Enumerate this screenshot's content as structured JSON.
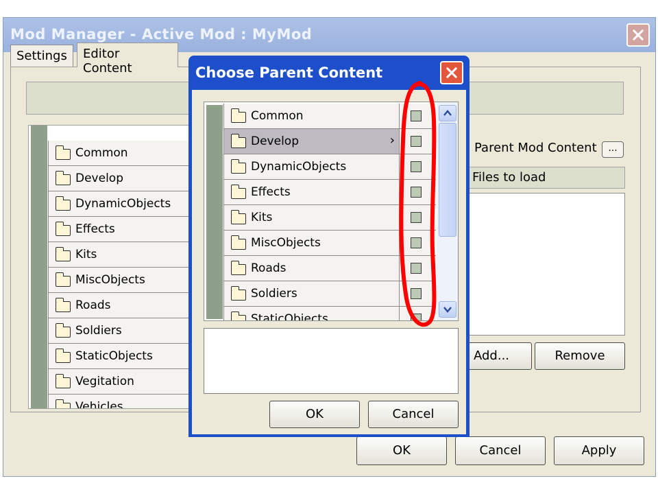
{
  "main_window": {
    "title": "Mod Manager - Active Mod : MyMod",
    "tabs": [
      {
        "label": "Settings"
      },
      {
        "label": "Editor Content"
      }
    ],
    "folders": [
      "Common",
      "Develop",
      "DynamicObjects",
      "Effects",
      "Kits",
      "MiscObjects",
      "Roads",
      "Soldiers",
      "StaticObjects",
      "Vegitation",
      "Vehicles"
    ],
    "parent_mod_label": "Parent Mod Content",
    "browse_label": "...",
    "files_header": "Files to load",
    "add_label": "Add...",
    "remove_label": "Remove",
    "ok_label": "OK",
    "cancel_label": "Cancel",
    "apply_label": "Apply"
  },
  "dialog": {
    "title": "Choose Parent Content",
    "folders": [
      "Common",
      "Develop",
      "DynamicObjects",
      "Effects",
      "Kits",
      "MiscObjects",
      "Roads",
      "Soldiers",
      "StaticObjects"
    ],
    "selected_index": 1,
    "ok_label": "OK",
    "cancel_label": "Cancel"
  },
  "colors": {
    "dialog_frame": "#1c4fc9",
    "annotation": "#ff0000",
    "gutter": "#8fa08a"
  }
}
